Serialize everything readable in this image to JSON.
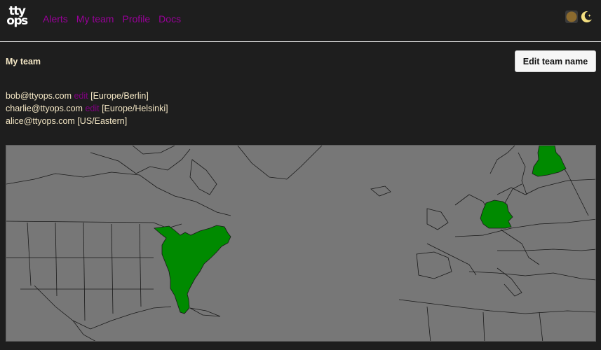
{
  "brand": {
    "logo_line1": "tty",
    "logo_line2": "ops"
  },
  "nav": {
    "items": [
      {
        "label": "Alerts"
      },
      {
        "label": "My team"
      },
      {
        "label": "Profile"
      },
      {
        "label": "Docs"
      }
    ]
  },
  "theme": {
    "light_icon": "sun-icon",
    "dark_icon": "moon-icon",
    "accent": "#f4e080"
  },
  "page": {
    "title": "My team",
    "edit_button_label": "Edit team name"
  },
  "team": {
    "members": [
      {
        "email": "bob@ttyops.com",
        "edit_label": "edit",
        "timezone": "[Europe/Berlin]"
      },
      {
        "email": "charlie@ttyops.com",
        "edit_label": "edit",
        "timezone": "[Europe/Helsinki]"
      },
      {
        "email": "alice@ttyops.com",
        "timezone": "[US/Eastern]"
      }
    ]
  },
  "map": {
    "highlight_color": "#008a00",
    "land_color": "#777777",
    "border_color": "#1a1a1a",
    "highlighted_regions": [
      "US/Eastern",
      "Germany",
      "Finland"
    ]
  }
}
